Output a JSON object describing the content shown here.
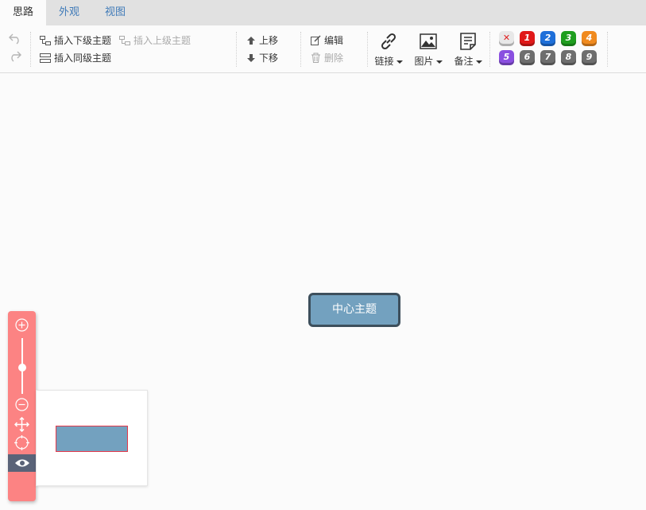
{
  "tabs": [
    {
      "label": "思路",
      "active": true
    },
    {
      "label": "外观",
      "active": false
    },
    {
      "label": "视图",
      "active": false
    }
  ],
  "toolbar": {
    "undo_icon": "undo-icon",
    "redo_icon": "redo-icon",
    "insert_child": "插入下级主题",
    "insert_parent": "插入上级主题",
    "insert_sibling": "插入同级主题",
    "move_up": "上移",
    "move_down": "下移",
    "edit": "编辑",
    "delete": "删除",
    "link": "链接",
    "image": "图片",
    "note": "备注"
  },
  "priorities": [
    {
      "label": "✕",
      "color": "#e8e8e8",
      "text_color": "#e02020"
    },
    {
      "label": "1",
      "color": "#e01818"
    },
    {
      "label": "2",
      "color": "#1e6fd9"
    },
    {
      "label": "3",
      "color": "#1f9e1f"
    },
    {
      "label": "4",
      "color": "#f08a1e"
    },
    {
      "label": "5",
      "color": "#8a4fe0"
    },
    {
      "label": "6",
      "color": "#6e6e6e"
    },
    {
      "label": "7",
      "color": "#6e6e6e"
    },
    {
      "label": "8",
      "color": "#6e6e6e"
    },
    {
      "label": "9",
      "color": "#6e6e6e"
    }
  ],
  "canvas": {
    "main_topic": "中心主题",
    "topic_color": "#73a1bf",
    "topic_border": "#3d4f5c"
  },
  "navigator": {
    "color": "#fc8383",
    "zoom_level": 0.5
  }
}
